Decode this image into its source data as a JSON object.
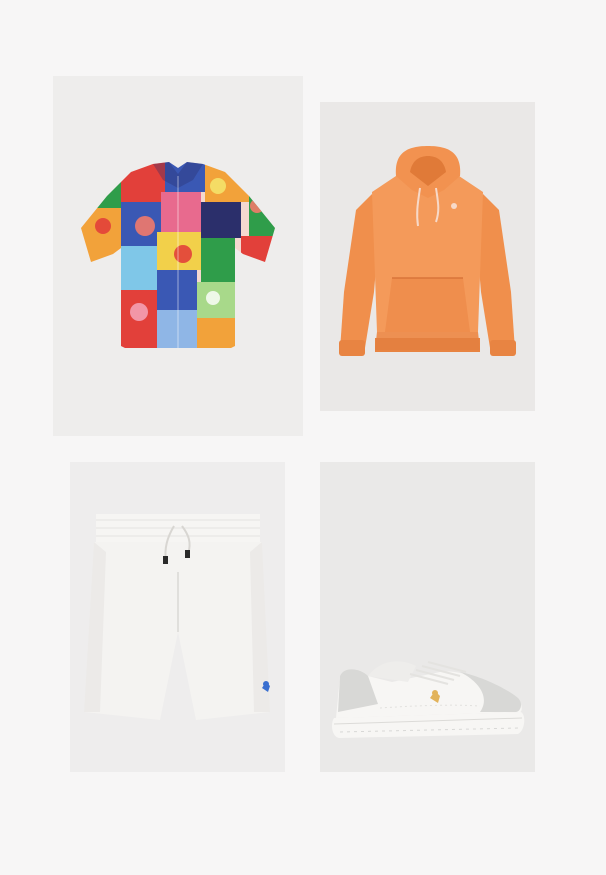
{
  "products": [
    {
      "key": "shirt",
      "icon": "floral-patchwork-shirt-icon",
      "background": "#eeedec",
      "colors": [
        "#e2403a",
        "#2f9d4a",
        "#3a58b4",
        "#f2a23a",
        "#f4d8d0"
      ]
    },
    {
      "key": "hoodie",
      "icon": "orange-hoodie-icon",
      "background": "#eae8e7",
      "colors": [
        "#f49a5a",
        "#f7d9c8"
      ]
    },
    {
      "key": "shorts",
      "icon": "white-shorts-icon",
      "background": "#eeeded",
      "colors": [
        "#f4f3f1",
        "#3a6fd0"
      ]
    },
    {
      "key": "sneaker",
      "icon": "white-sneaker-icon",
      "background": "#eae9e8",
      "colors": [
        "#f7f6f4",
        "#d8d8d6",
        "#e2b35a"
      ]
    }
  ]
}
